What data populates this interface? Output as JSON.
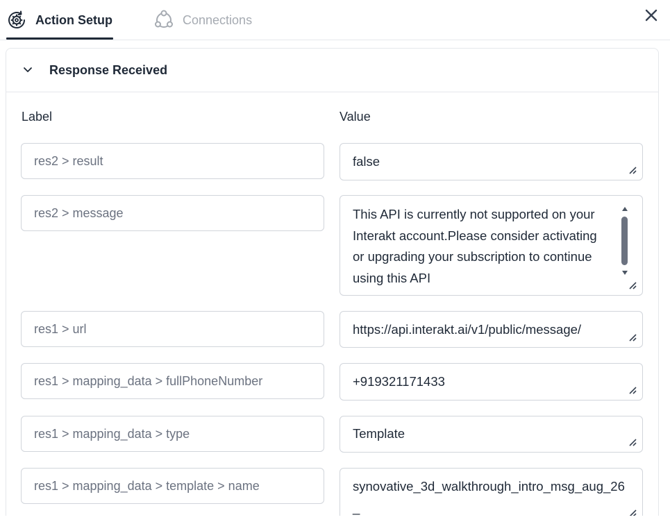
{
  "tabs": [
    {
      "label": "Action Setup",
      "icon": "gear-cycle-icon",
      "active": true
    },
    {
      "label": "Connections",
      "icon": "connections-icon",
      "active": false
    }
  ],
  "close_icon": "close-icon",
  "section": {
    "title": "Response Received",
    "expanded": true,
    "label_header": "Label",
    "value_header": "Value"
  },
  "rows": [
    {
      "label": "res2 > result",
      "value": "false"
    },
    {
      "label": "res2 > message",
      "value": "This API is currently not supported on your Interakt account.Please consider activating or upgrading your subscription to continue using this API"
    },
    {
      "label": "res1 > url",
      "value": "https://api.interakt.ai/v1/public/message/"
    },
    {
      "label": "res1 > mapping_data > fullPhoneNumber",
      "value": "+919321171433"
    },
    {
      "label": "res1 > mapping_data > type",
      "value": "Template"
    },
    {
      "label": "res1 > mapping_data > template > name",
      "value": "synovative_3d_walkthrough_intro_msg_aug_26_"
    }
  ],
  "colors": {
    "text_primary": "#1f2937",
    "text_muted": "#6b7280",
    "tab_inactive": "#a6abb2",
    "border": "#d1d5db"
  }
}
